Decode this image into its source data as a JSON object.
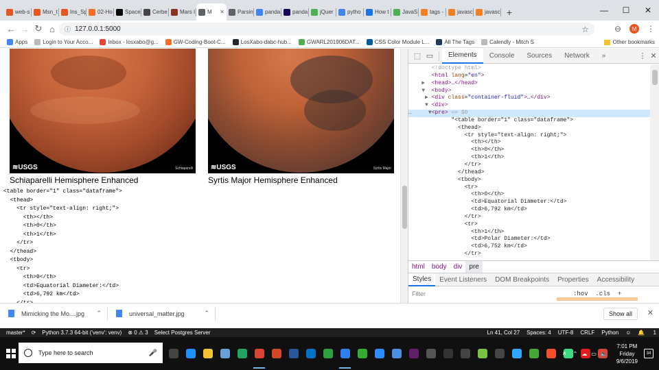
{
  "colors": {
    "accent": "#1a73e8",
    "tag": "#881280",
    "attr_name": "#994500",
    "attr_value": "#1a1aa6",
    "comment": "#a0a0a0"
  },
  "tabs": [
    {
      "label": "web-s",
      "icon": "ring-icon",
      "color": "#e8551e"
    },
    {
      "label": "Msn_t",
      "icon": "bookmark-icon",
      "color": "#e8551e"
    },
    {
      "label": "Ins_Sp",
      "icon": "bookmark-icon",
      "color": "#e8551e"
    },
    {
      "label": "02-Ho",
      "icon": "gitlab-icon",
      "color": "#fc6d26"
    },
    {
      "label": "Space",
      "icon": "spacex-icon",
      "color": "#000000"
    },
    {
      "label": "Cerbe",
      "icon": "cerberus-icon",
      "color": "#444444"
    },
    {
      "label": "Mars I",
      "icon": "mars-icon",
      "color": "#8a3322"
    },
    {
      "label": "M",
      "icon": "globe-icon",
      "color": "#5f6368",
      "active": true
    },
    {
      "label": "Parsin",
      "icon": "globe-icon",
      "color": "#5f6368"
    },
    {
      "label": "panda",
      "icon": "google-icon",
      "color": "#4285f4"
    },
    {
      "label": "panda",
      "icon": "pandas-icon",
      "color": "#150458"
    },
    {
      "label": "jQuer",
      "icon": "w3schools-icon",
      "color": "#4caf50"
    },
    {
      "label": "pytho",
      "icon": "google-icon",
      "color": "#4285f4"
    },
    {
      "label": "How t",
      "icon": "arrow-icon",
      "color": "#1a73e8"
    },
    {
      "label": "JavaS",
      "icon": "w3schools-icon",
      "color": "#4caf50"
    },
    {
      "label": "tags -",
      "icon": "stackoverflow-icon",
      "color": "#f48024"
    },
    {
      "label": "javasc",
      "icon": "stackoverflow-icon",
      "color": "#f48024"
    },
    {
      "label": "javasc",
      "icon": "stackoverflow-icon",
      "color": "#f48024"
    }
  ],
  "window": {
    "minimize": "—",
    "maximize": "☐",
    "close": "✕"
  },
  "nav": {
    "url": "127.0.0.1:5000",
    "avatar_letter": "M"
  },
  "bookmarks": [
    {
      "label": "Apps",
      "color": "#4285f4"
    },
    {
      "label": "Login to Your Acco...",
      "color": "#bbbbbb"
    },
    {
      "label": "Inbox - losxabo@g...",
      "color": "#ea4335"
    },
    {
      "label": "GW-Coding-Boot-C...",
      "color": "#fc6d26"
    },
    {
      "label": "LosXabo-dabc-hub...",
      "color": "#24292e"
    },
    {
      "label": "GWARL201906DAT...",
      "color": "#4caf50"
    },
    {
      "label": "CSS Color Module L...",
      "color": "#005a9c"
    },
    {
      "label": "All The Tags",
      "color": "#1e3a5f"
    },
    {
      "label": "Calendly - Mitch S",
      "color": "#bbbbbb"
    }
  ],
  "other_bookmarks": "Other bookmarks",
  "page": {
    "images": [
      {
        "logo": "≋USGS",
        "credit": "Schiaparelli",
        "title": "Schiaparelli Hemisphere Enhanced"
      },
      {
        "logo": "≋USGS",
        "credit": "Syrtis Major",
        "title": "Syrtis Major Hemisphere Enhanced"
      }
    ],
    "code": "<table border=\"1\" class=\"dataframe\">\n  <thead>\n    <tr style=\"text-align: right;\">\n      <th></th>\n      <th>0</th>\n      <th>1</th>\n    </tr>\n  </thead>\n  <tbody>\n    <tr>\n      <th>0</th>\n      <td>Equatorial Diameter:</td>\n      <td>6,792 km</td>\n    </tr>"
  },
  "devtools": {
    "tabs": [
      "Elements",
      "Console",
      "Sources",
      "Network"
    ],
    "more": "»",
    "breadcrumb": [
      "html",
      "body",
      "div",
      "pre"
    ],
    "style_tabs": [
      "Styles",
      "Event Listeners",
      "DOM Breakpoints",
      "Properties",
      "Accessibility"
    ],
    "filter_placeholder": "Filter",
    "filter_tools": ":hov  .cls  +"
  },
  "dom": [
    {
      "t": "",
      "html": "<span class='cm'>&lt;!doctype html&gt;</span>"
    },
    {
      "t": "",
      "html": "<span class='tg'>&lt;html</span> <span class='an'>lang</span>=<span class='av'>\"en\"</span><span class='tg'>&gt;</span>"
    },
    {
      "t": "▶",
      "html": "<span class='tg'>&lt;head&gt;</span>…<span class='tg'>&lt;/head&gt;</span>"
    },
    {
      "t": "▼",
      "html": "<span class='tg'>&lt;body&gt;</span>"
    },
    {
      "t": " ▶",
      "html": "<span class='tg'>&lt;div</span> <span class='an'>class</span>=<span class='av'>\"container-fluid\"</span><span class='tg'>&gt;</span>…<span class='tg'>&lt;/div&gt;</span>"
    },
    {
      "t": " ▼",
      "html": "<span class='tg'>&lt;div&gt;</span>"
    },
    {
      "t": "  ▼",
      "html": "<span class='tg'>&lt;pre&gt;</span> <span class='cm'>== $0</span>",
      "sel": true
    },
    {
      "t": "",
      "html": "      <span class='tx'>\"&lt;table border=\"1\" class=\"dataframe\"&gt;</span>"
    },
    {
      "t": "",
      "html": "        <span class='tx'>&lt;thead&gt;</span>"
    },
    {
      "t": "",
      "html": "          <span class='tx'>&lt;tr style=\"text-align: right;\"&gt;</span>"
    },
    {
      "t": "",
      "html": "            <span class='tx'>&lt;th&gt;&lt;/th&gt;</span>"
    },
    {
      "t": "",
      "html": "            <span class='tx'>&lt;th&gt;0&lt;/th&gt;</span>"
    },
    {
      "t": "",
      "html": "            <span class='tx'>&lt;th&gt;1&lt;/th&gt;</span>"
    },
    {
      "t": "",
      "html": "          <span class='tx'>&lt;/tr&gt;</span>"
    },
    {
      "t": "",
      "html": "        <span class='tx'>&lt;/thead&gt;</span>"
    },
    {
      "t": "",
      "html": "        <span class='tx'>&lt;tbody&gt;</span>"
    },
    {
      "t": "",
      "html": "          <span class='tx'>&lt;tr&gt;</span>"
    },
    {
      "t": "",
      "html": "            <span class='tx'>&lt;th&gt;0&lt;/th&gt;</span>"
    },
    {
      "t": "",
      "html": "            <span class='tx'>&lt;td&gt;Equatorial Diameter:&lt;/td&gt;</span>"
    },
    {
      "t": "",
      "html": "            <span class='tx'>&lt;td&gt;6,792 km&lt;/td&gt;</span>"
    },
    {
      "t": "",
      "html": "          <span class='tx'>&lt;/tr&gt;</span>"
    },
    {
      "t": "",
      "html": "          <span class='tx'>&lt;tr&gt;</span>"
    },
    {
      "t": "",
      "html": "            <span class='tx'>&lt;th&gt;1&lt;/th&gt;</span>"
    },
    {
      "t": "",
      "html": "            <span class='tx'>&lt;td&gt;Polar Diameter:&lt;/td&gt;</span>"
    },
    {
      "t": "",
      "html": "            <span class='tx'>&lt;td&gt;6,752 km&lt;/td&gt;</span>"
    },
    {
      "t": "",
      "html": "          <span class='tx'>&lt;/tr&gt;</span>"
    }
  ],
  "downloads": [
    {
      "name": "Mimicking the Mo....jpg"
    },
    {
      "name": "universal_matter.jpg"
    }
  ],
  "show_all": "Show all",
  "statusbar": {
    "branch": "master*",
    "python": "Python 3.7.3 64-bit ('venv': venv)",
    "problems": "⊗ 0 ⚠ 3",
    "server": "Select Postgres Server",
    "position": "Ln 41, Col 27",
    "spaces": "Spaces: 4",
    "encoding": "UTF-8",
    "eol": "CRLF",
    "language": "Python",
    "notif": "1"
  },
  "taskbar": {
    "search_placeholder": "Type here to search",
    "time": "7:01 PM",
    "day": "Friday",
    "date": "9/6/2019",
    "notifications": "34",
    "apps": [
      {
        "name": "task-view-icon",
        "color": "#444444"
      },
      {
        "name": "edge-icon",
        "color": "#1e90ff"
      },
      {
        "name": "file-explorer-icon",
        "color": "#f2c230"
      },
      {
        "name": "store-icon",
        "color": "#6a9fd8"
      },
      {
        "name": "excel-icon",
        "color": "#21a366"
      },
      {
        "name": "chrome-icon",
        "color": "#db4437",
        "on": true
      },
      {
        "name": "powerpoint-icon",
        "color": "#d24726"
      },
      {
        "name": "word-icon",
        "color": "#2b579a"
      },
      {
        "name": "outlook-icon",
        "color": "#0072c6"
      },
      {
        "name": "git-icon",
        "color": "#2ea043"
      },
      {
        "name": "vscode-icon",
        "color": "#2f80ed",
        "on": true
      },
      {
        "name": "refresh-icon",
        "color": "#33aa33"
      },
      {
        "name": "zoom-icon",
        "color": "#2d8cff"
      },
      {
        "name": "photos-icon",
        "color": "#4a90e2"
      },
      {
        "name": "slack-icon",
        "color": "#611f69"
      },
      {
        "name": "calculator-icon",
        "color": "#555555"
      },
      {
        "name": "terminal-icon",
        "color": "#333333"
      },
      {
        "name": "notes-icon",
        "color": "#444444"
      },
      {
        "name": "camtasia-icon",
        "color": "#7ac143"
      },
      {
        "name": "kitty-icon",
        "color": "#444444"
      },
      {
        "name": "photoshop-icon",
        "color": "#31a8ff"
      },
      {
        "name": "anaconda-icon",
        "color": "#44a833"
      },
      {
        "name": "git-bash-icon",
        "color": "#f34f29"
      },
      {
        "name": "android-icon",
        "color": "#3ddc84"
      },
      {
        "name": "acrobat-icon",
        "color": "#e01e1e"
      },
      {
        "name": "chrome-alt-icon",
        "color": "#db4437"
      }
    ]
  }
}
